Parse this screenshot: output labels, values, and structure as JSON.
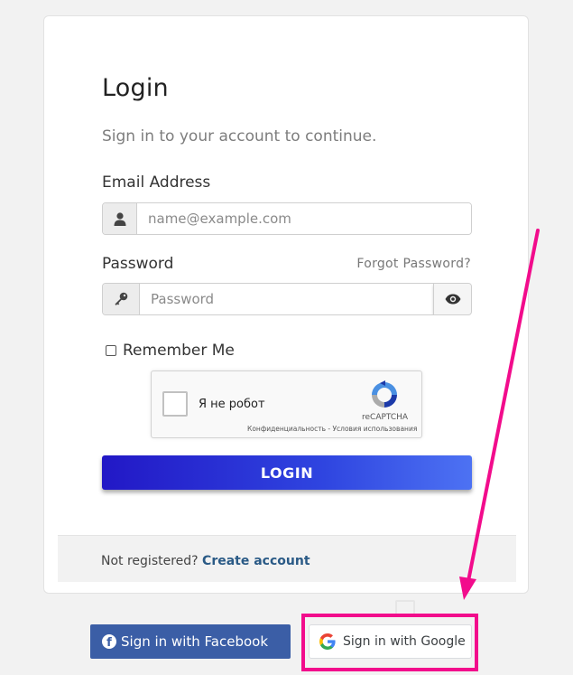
{
  "login": {
    "title": "Login",
    "subtitle": "Sign in to your account to continue.",
    "email_label": "Email Address",
    "email_placeholder": "name@example.com",
    "password_label": "Password",
    "forgot_password": "Forgot Password?",
    "password_placeholder": "Password",
    "remember_me": "Remember Me",
    "remember_checked": false,
    "login_button": "LOGIN"
  },
  "recaptcha": {
    "label": "Я не робот",
    "brand": "reCAPTCHA",
    "links": "Конфиденциальность - Условия использования"
  },
  "footer": {
    "not_registered": "Not registered?",
    "create_account": "Create account"
  },
  "social": {
    "facebook": "Sign in with Facebook",
    "google": "Sign in with Google"
  },
  "icons": {
    "email": "user-icon",
    "password": "key-icon",
    "toggle": "eye-icon"
  },
  "colors": {
    "login_button": "#2f45e0",
    "facebook": "#3b5ea6",
    "annotation": "#f20c8c",
    "link": "#2a5a86"
  }
}
